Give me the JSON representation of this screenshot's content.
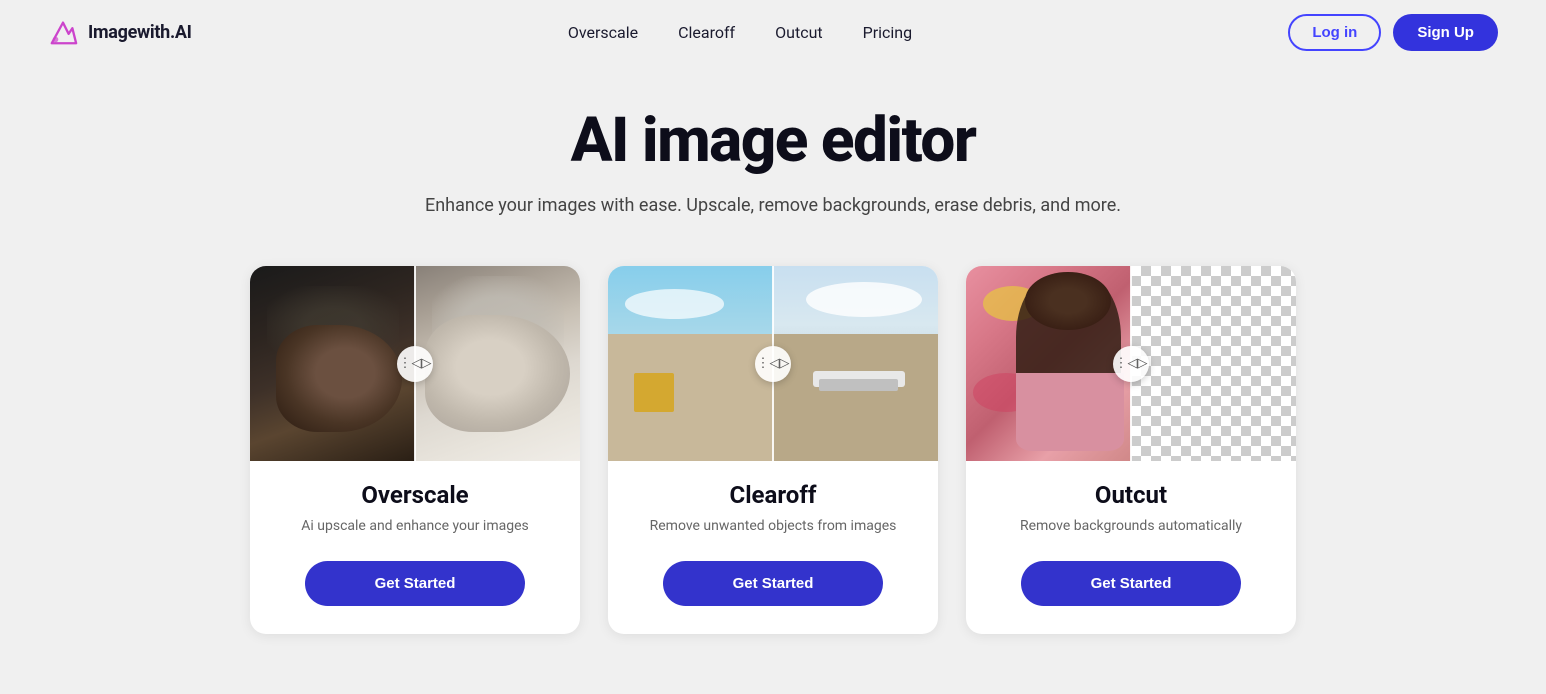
{
  "logo": {
    "text": "Imagewith.AI"
  },
  "nav": {
    "items": [
      {
        "label": "Overscale",
        "id": "overscale"
      },
      {
        "label": "Clearoff",
        "id": "clearoff"
      },
      {
        "label": "Outcut",
        "id": "outcut"
      },
      {
        "label": "Pricing",
        "id": "pricing"
      }
    ]
  },
  "header": {
    "login_label": "Log in",
    "signup_label": "Sign Up"
  },
  "hero": {
    "title": "AI image editor",
    "subtitle": "Enhance your images with ease. Upscale, remove backgrounds, erase debris, and more."
  },
  "cards": [
    {
      "id": "overscale",
      "title": "Overscale",
      "description": "Ai upscale and enhance your images",
      "cta": "Get Started"
    },
    {
      "id": "clearoff",
      "title": "Clearoff",
      "description": "Remove unwanted objects from images",
      "cta": "Get Started"
    },
    {
      "id": "outcut",
      "title": "Outcut",
      "description": "Remove backgrounds automatically",
      "cta": "Get Started"
    }
  ],
  "colors": {
    "accent": "#3333cc",
    "login_border": "#4444ff",
    "text_dark": "#0d0d1a"
  }
}
